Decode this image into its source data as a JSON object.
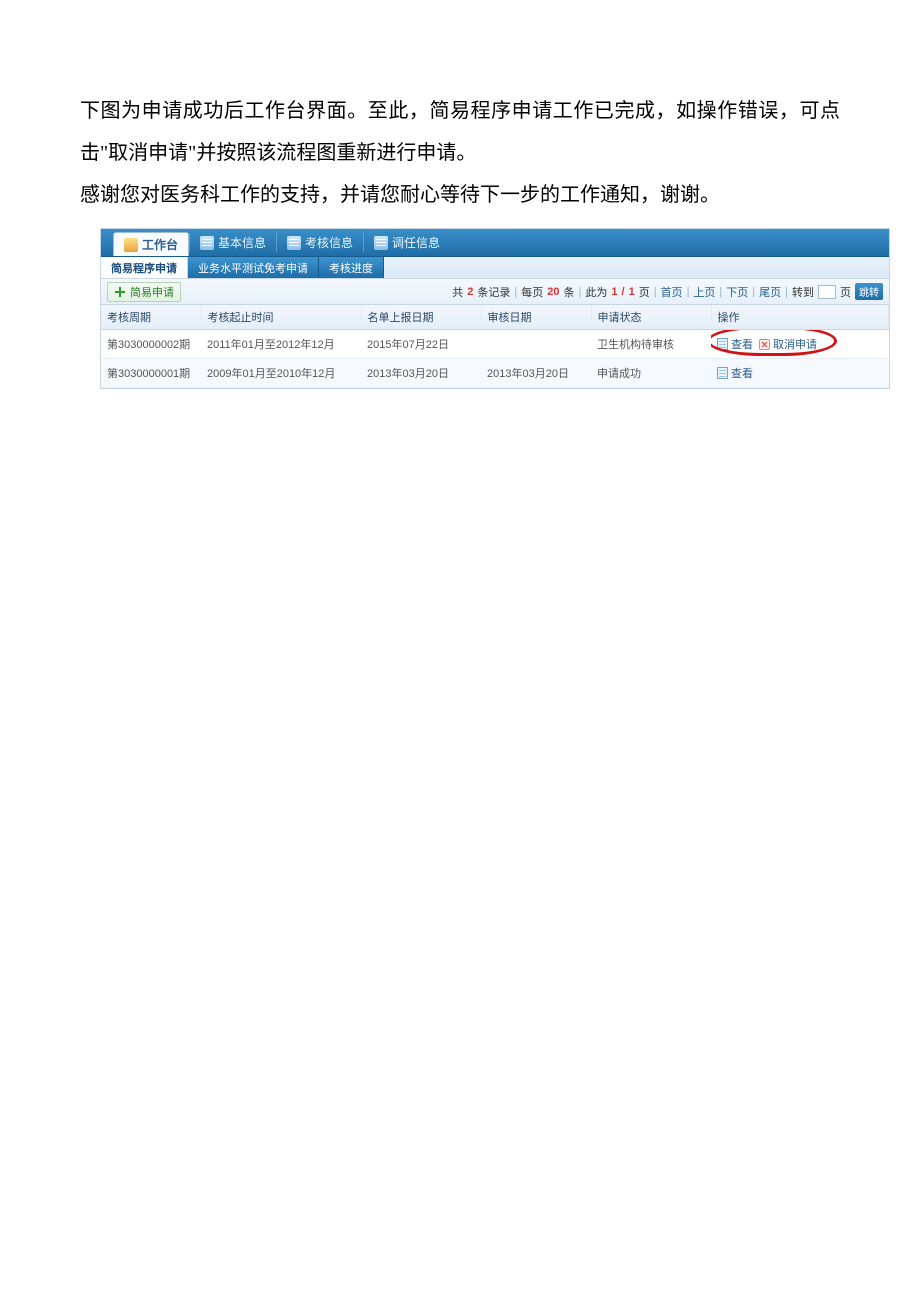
{
  "intro": {
    "p1": "下图为申请成功后工作台界面。至此，简易程序申请工作已完成，如操作错误，可点击\"取消申请\"并按照该流程图重新进行申请。",
    "p2": "感谢您对医务科工作的支持，并请您耐心等待下一步的工作通知，谢谢。"
  },
  "nav": {
    "tabs": [
      {
        "label": "工作台",
        "active": true
      },
      {
        "label": "基本信息",
        "active": false
      },
      {
        "label": "考核信息",
        "active": false
      },
      {
        "label": "调任信息",
        "active": false
      }
    ]
  },
  "subnav": {
    "tabs": [
      {
        "label": "简易程序申请",
        "style": "active"
      },
      {
        "label": "业务水平测试免考申请",
        "style": "pill"
      },
      {
        "label": "考核进度",
        "style": "pill"
      }
    ]
  },
  "toolbar": {
    "add_label": "简易申请"
  },
  "pager": {
    "prefix": "共",
    "total": "2",
    "records_suffix": "条记录",
    "sep": "|",
    "perpage_prefix": "每页",
    "perpage": "20",
    "perpage_suffix": "条",
    "pos_prefix": "此为",
    "page_cur": "1",
    "page_sep": "/",
    "page_total": "1",
    "page_suffix": "页",
    "first": "首页",
    "prev": "上页",
    "next": "下页",
    "last": "尾页",
    "goto_prefix": "转到",
    "goto_value": "",
    "goto_suffix": "页",
    "go_btn": "跳转"
  },
  "table": {
    "headers": {
      "c0": "考核周期",
      "c1": "考核起止时间",
      "c2": "名单上报日期",
      "c3": "审核日期",
      "c4": "申请状态",
      "c5": "操作"
    },
    "rows": [
      {
        "period": "第3030000002期",
        "range": "2011年01月至2012年12月",
        "report": "2015年07月22日",
        "review": "",
        "status": "卫生机构待审核",
        "ops": {
          "view": "查看",
          "cancel": "取消申请"
        }
      },
      {
        "period": "第3030000001期",
        "range": "2009年01月至2010年12月",
        "report": "2013年03月20日",
        "review": "2013年03月20日",
        "status": "申请成功",
        "ops": {
          "view": "查看"
        }
      }
    ]
  }
}
